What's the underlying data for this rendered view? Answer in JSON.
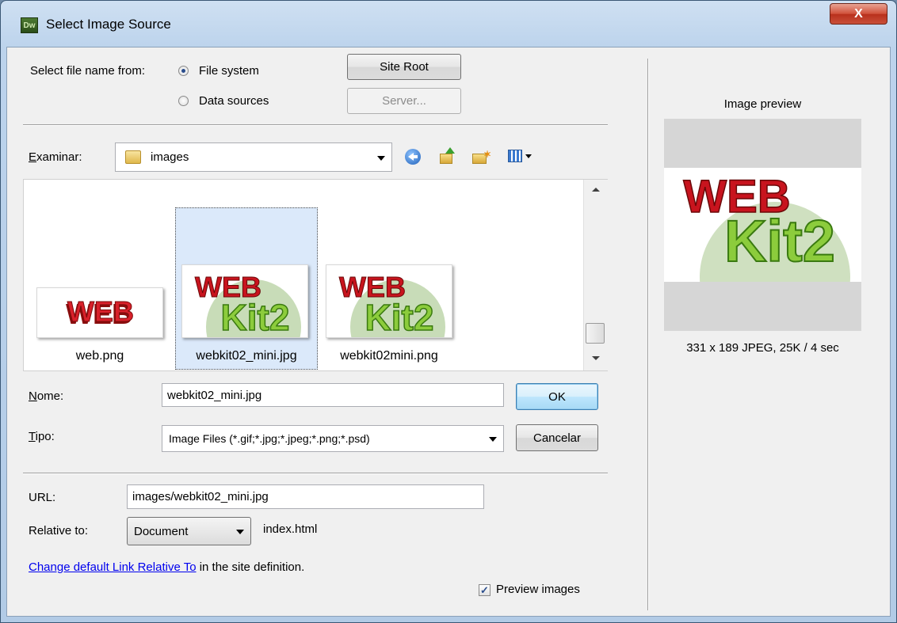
{
  "window": {
    "title": "Select Image Source",
    "app_icon_text": "Dw",
    "close_glyph": "X"
  },
  "source": {
    "label": "Select file name from:",
    "options": [
      {
        "label": "File system",
        "selected": true
      },
      {
        "label": "Data sources",
        "selected": false
      }
    ],
    "site_root_label": "Site Root",
    "server_label": "Server..."
  },
  "browse": {
    "label": "Examinar:",
    "folder": "images",
    "toolbar_icons": [
      "back-icon",
      "up-folder-icon",
      "new-folder-icon",
      "view-menu-icon"
    ]
  },
  "files": [
    {
      "name": "web.png",
      "selected": false,
      "image": "web-logo"
    },
    {
      "name": "webkit02_mini.jpg",
      "selected": true,
      "image": "webkit2-logo"
    },
    {
      "name": "webkit02mini.png",
      "selected": false,
      "image": "webkit2-logo"
    }
  ],
  "name_row": {
    "label": "Nome:",
    "value": "webkit02_mini.jpg",
    "ok_label": "OK"
  },
  "type_row": {
    "label": "Tipo:",
    "value": "Image Files (*.gif;*.jpg;*.jpeg;*.png;*.psd)",
    "cancel_label": "Cancelar"
  },
  "url_row": {
    "label": "URL:",
    "value": "images/webkit02_mini.jpg"
  },
  "relative_row": {
    "label": "Relative to:",
    "value": "Document",
    "file": "index.html"
  },
  "link_row": {
    "link_text": "Change default Link Relative To",
    "suffix": " in the site definition."
  },
  "preview_images": {
    "label": "Preview images",
    "checked": true
  },
  "preview": {
    "title": "Image preview",
    "info": "331 x 189 JPEG, 25K / 4 sec"
  }
}
